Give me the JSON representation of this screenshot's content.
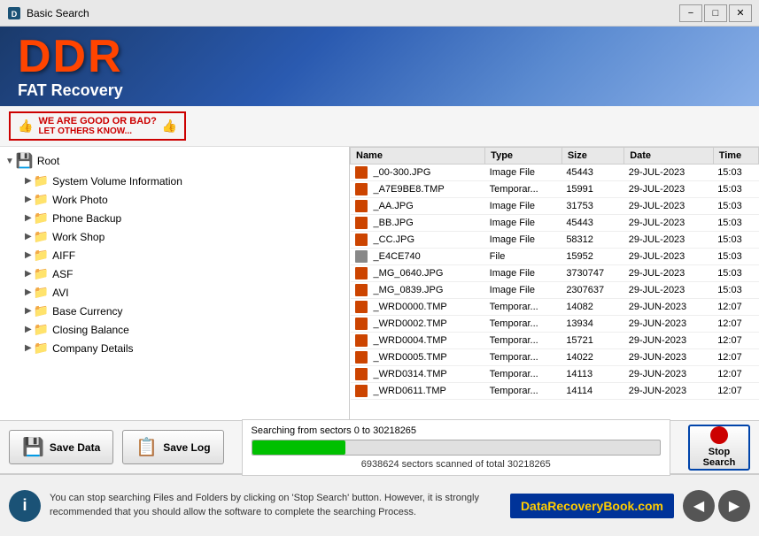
{
  "titleBar": {
    "title": "Basic Search",
    "minimize": "−",
    "maximize": "□",
    "close": "✕"
  },
  "header": {
    "ddr": "DDR",
    "subtitle": "FAT Recovery"
  },
  "banner": {
    "line1": "WE ARE GOOD OR BAD?",
    "line2": "LET OTHERS KNOW..."
  },
  "tree": {
    "root": "Root",
    "items": [
      {
        "label": "System Volume Information",
        "indent": 1,
        "expanded": false
      },
      {
        "label": "Work Photo",
        "indent": 1,
        "expanded": false
      },
      {
        "label": "Phone Backup",
        "indent": 1,
        "expanded": false
      },
      {
        "label": "Work Shop",
        "indent": 1,
        "expanded": false
      },
      {
        "label": "AIFF",
        "indent": 1,
        "expanded": false
      },
      {
        "label": "ASF",
        "indent": 1,
        "expanded": false
      },
      {
        "label": "AVI",
        "indent": 1,
        "expanded": false
      },
      {
        "label": "Base Currency",
        "indent": 1,
        "expanded": false
      },
      {
        "label": "Closing Balance",
        "indent": 1,
        "expanded": false
      },
      {
        "label": "Company Details",
        "indent": 1,
        "expanded": false
      }
    ]
  },
  "fileTable": {
    "headers": [
      "Name",
      "Type",
      "Size",
      "Date",
      "Time"
    ],
    "rows": [
      {
        "name": "_00-300.JPG",
        "type": "Image File",
        "size": "45443",
        "date": "29-JUL-2023",
        "time": "15:03"
      },
      {
        "name": "_A7E9BE8.TMP",
        "type": "Temporar...",
        "size": "15991",
        "date": "29-JUL-2023",
        "time": "15:03"
      },
      {
        "name": "_AA.JPG",
        "type": "Image File",
        "size": "31753",
        "date": "29-JUL-2023",
        "time": "15:03"
      },
      {
        "name": "_BB.JPG",
        "type": "Image File",
        "size": "45443",
        "date": "29-JUL-2023",
        "time": "15:03"
      },
      {
        "name": "_CC.JPG",
        "type": "Image File",
        "size": "58312",
        "date": "29-JUL-2023",
        "time": "15:03"
      },
      {
        "name": "_E4CE740",
        "type": "File",
        "size": "15952",
        "date": "29-JUL-2023",
        "time": "15:03"
      },
      {
        "name": "_MG_0640.JPG",
        "type": "Image File",
        "size": "3730747",
        "date": "29-JUL-2023",
        "time": "15:03"
      },
      {
        "name": "_MG_0839.JPG",
        "type": "Image File",
        "size": "2307637",
        "date": "29-JUL-2023",
        "time": "15:03"
      },
      {
        "name": "_WRD0000.TMP",
        "type": "Temporar...",
        "size": "14082",
        "date": "29-JUN-2023",
        "time": "12:07"
      },
      {
        "name": "_WRD0002.TMP",
        "type": "Temporar...",
        "size": "13934",
        "date": "29-JUN-2023",
        "time": "12:07"
      },
      {
        "name": "_WRD0004.TMP",
        "type": "Temporar...",
        "size": "15721",
        "date": "29-JUN-2023",
        "time": "12:07"
      },
      {
        "name": "_WRD0005.TMP",
        "type": "Temporar...",
        "size": "14022",
        "date": "29-JUN-2023",
        "time": "12:07"
      },
      {
        "name": "_WRD0314.TMP",
        "type": "Temporar...",
        "size": "14113",
        "date": "29-JUN-2023",
        "time": "12:07"
      },
      {
        "name": "_WRD0611.TMP",
        "type": "Temporar...",
        "size": "14114",
        "date": "29-JUN-2023",
        "time": "12:07"
      }
    ]
  },
  "toolbar": {
    "saveData": "Save Data",
    "saveLog": "Save Log"
  },
  "search": {
    "statusText": "Searching from sectors  0 to 30218265",
    "progressPercent": 23,
    "scannedText": "6938624  sectors scanned of total 30218265",
    "stopLine1": "Stop",
    "stopLine2": "Search"
  },
  "statusBar": {
    "message": "You can stop searching Files and Folders by clicking on 'Stop Search' button. However, it is strongly recommended that you should allow the software to complete the searching Process.",
    "brand": "DataRecoveryBook.com"
  }
}
